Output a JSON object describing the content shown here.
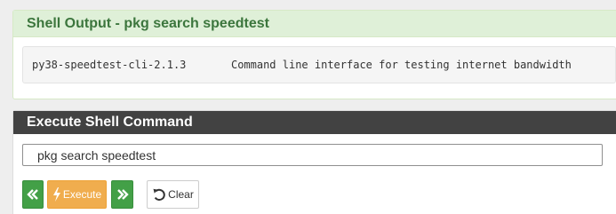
{
  "output_panel": {
    "title": "Shell Output - pkg search speedtest",
    "output_text": "py38-speedtest-cli-2.1.3       Command line interface for testing internet bandwidth"
  },
  "execute_panel": {
    "title": "Execute Shell Command",
    "command_value": "pkg search speedtest",
    "buttons": {
      "previous_icon": "double-chevron-left-icon",
      "execute_label": "Execute",
      "execute_icon": "lightning-bolt-icon",
      "next_icon": "double-chevron-right-icon",
      "clear_label": "Clear",
      "clear_icon": "undo-icon"
    }
  },
  "colors": {
    "success_bg": "#dff0d8",
    "success_text": "#3c763d",
    "dark_header": "#424242",
    "green_button": "#43a047",
    "orange_button": "#f0ad4e"
  }
}
